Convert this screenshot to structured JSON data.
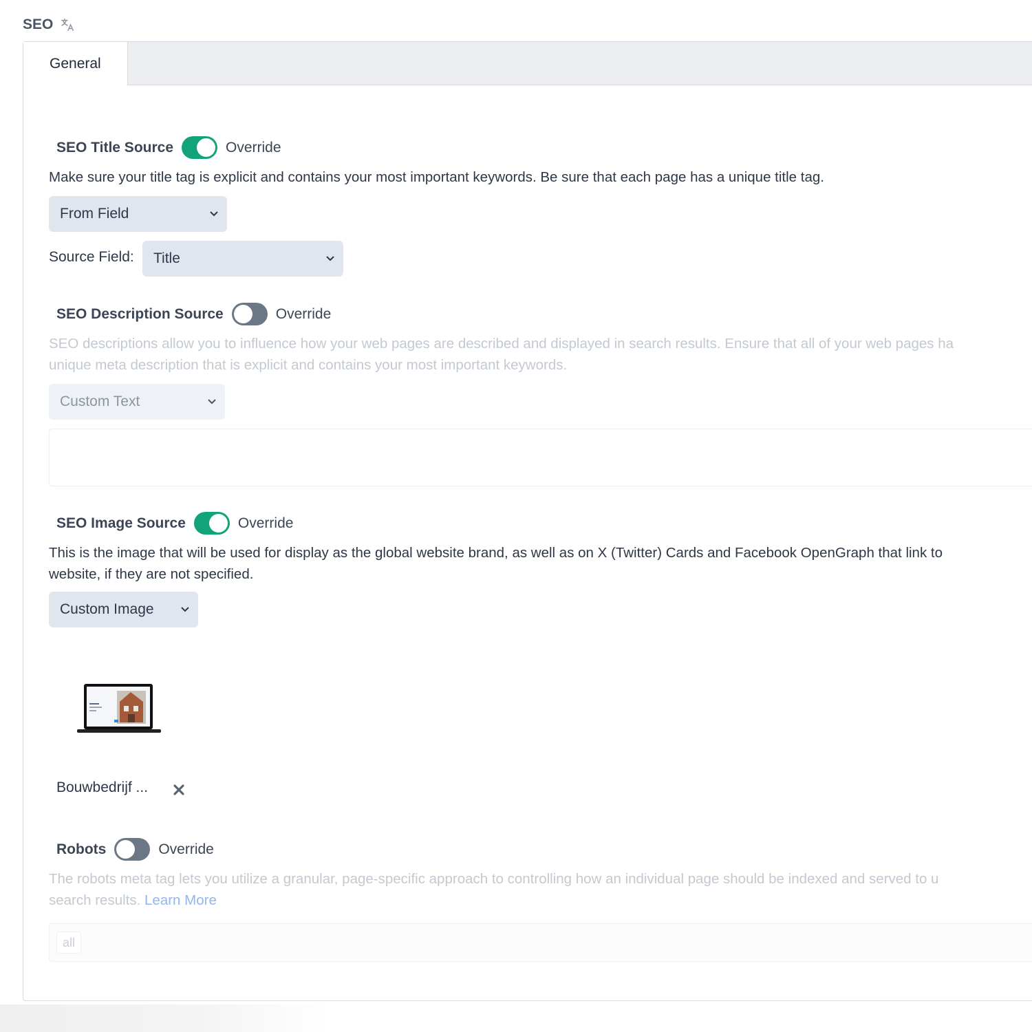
{
  "field": {
    "title": "SEO",
    "translate_icon": "translate-icon"
  },
  "tabs": [
    {
      "label": "General",
      "active": true
    }
  ],
  "colors": {
    "toggle_on": "#12a37a",
    "toggle_off": "#6b7785",
    "select_bg": "#e1e6ee",
    "link": "#93b6ec"
  },
  "title_source": {
    "label": "SEO Title Source",
    "override_label": "Override",
    "override_on": true,
    "description": "Make sure your title tag is explicit and contains your most important keywords. Be sure that each page has a unique title tag.",
    "source_select": "From Field",
    "source_field_label": "Source Field:",
    "source_field_value": "Title"
  },
  "description_source": {
    "label": "SEO Description Source",
    "override_label": "Override",
    "override_on": false,
    "description_line1": "SEO descriptions allow you to influence how your web pages are described and displayed in search results. Ensure that all of your web pages ha",
    "description_line2": "unique meta description that is explicit and contains your most important keywords.",
    "source_select": "Custom Text",
    "text_value": ""
  },
  "image_source": {
    "label": "SEO Image Source",
    "override_label": "Override",
    "override_on": true,
    "description_line1": "This is the image that will be used for display as the global website brand, as well as on X (Twitter) Cards and Facebook OpenGraph that link to",
    "description_line2": "website, if they are not specified.",
    "source_select": "Custom Image",
    "asset_name": "Bouwbedrijf ...",
    "remove_icon": "close-icon"
  },
  "robots": {
    "label": "Robots",
    "override_label": "Override",
    "override_on": false,
    "description_line1": "The robots meta tag lets you utilize a granular, page-specific approach to controlling how an individual page should be indexed and served to u",
    "description_line2": "search results.",
    "learn_more": "Learn More",
    "tags": [
      "all"
    ]
  }
}
